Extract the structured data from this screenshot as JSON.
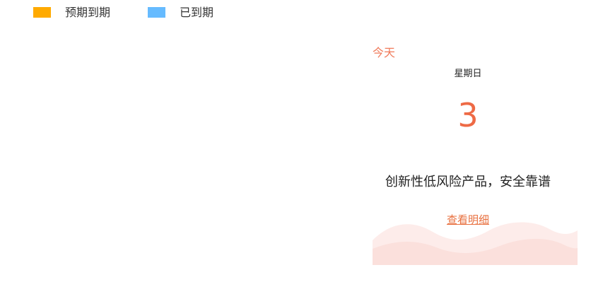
{
  "legend": {
    "items": [
      {
        "label": "预期到期",
        "color": "#ffaa00"
      },
      {
        "label": "已到期",
        "color": "#66bbff"
      }
    ]
  },
  "today_panel": {
    "today_label": "今天",
    "weekday": "星期日",
    "day_number": "3",
    "slogan": "创新性低风险产品，安全靠谱",
    "details_link": "查看明细",
    "colors": {
      "accent": "#ee6a45",
      "wave_light": "#fdecea",
      "wave_dark": "#fbe0dc"
    }
  }
}
